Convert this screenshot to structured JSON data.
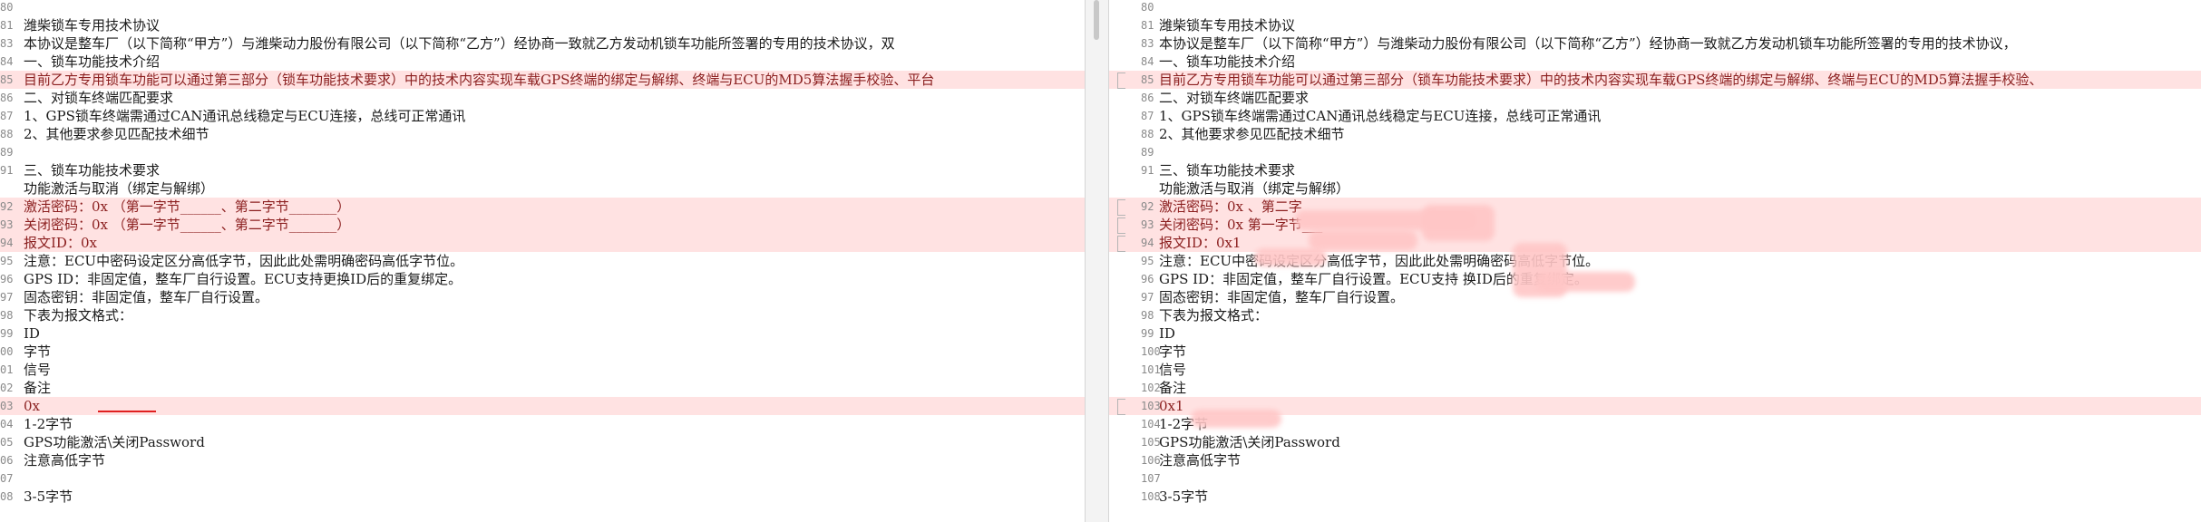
{
  "left_pane": {
    "lines": [
      {
        "num": "80",
        "text": "",
        "changed": false
      },
      {
        "num": "81",
        "text": "潍柴锁车专用技术协议",
        "changed": false
      },
      {
        "num": "83",
        "text": "本协议是整车厂（以下简称“甲方”）与潍柴动力股份有限公司（以下简称“乙方”）经协商一致就乙方发动机锁车功能所签署的专用的技术协议，双",
        "changed": false
      },
      {
        "num": "84",
        "text": "一、锁车功能技术介绍",
        "changed": false
      },
      {
        "num": "85",
        "text": "目前乙方专用锁车功能可以通过第三部分（锁车功能技术要求）中的技术内容实现车载GPS终端的绑定与解绑、终端与ECU的MD5算法握手校验、平台",
        "changed": true
      },
      {
        "num": "86",
        "text": "二、对锁车终端匹配要求",
        "changed": false
      },
      {
        "num": "87",
        "text": "1、GPS锁车终端需通过CAN通讯总线稳定与ECU连接，总线可正常通讯",
        "changed": false
      },
      {
        "num": "88",
        "text": "2、其他要求参见匹配技术细节",
        "changed": false
      },
      {
        "num": "89",
        "text": "",
        "changed": false
      },
      {
        "num": "91",
        "text": "三、锁车功能技术要求",
        "changed": false
      },
      {
        "num": "",
        "text": "功能激活与取消（绑定与解绑）",
        "changed": false
      },
      {
        "num": "92",
        "text": "  激活密码：0x  （第一字节______、第二字节_______）",
        "changed": true
      },
      {
        "num": "93",
        "text": "  关闭密码：0x  （第一字节______、第二字节_______）",
        "changed": true
      },
      {
        "num": "94",
        "text": "  报文ID：0x",
        "changed": true
      },
      {
        "num": "95",
        "text": "注意：ECU中密码设定区分高低字节，因此此处需明确密码高低字节位。",
        "changed": false
      },
      {
        "num": "96",
        "text": "GPS ID：非固定值，整车厂自行设置。ECU支持更换ID后的重复绑定。",
        "changed": false
      },
      {
        "num": "97",
        "text": "固态密钥：非固定值，整车厂自行设置。",
        "changed": false
      },
      {
        "num": "98",
        "text": "下表为报文格式：",
        "changed": false
      },
      {
        "num": "99",
        "text": "ID",
        "changed": false
      },
      {
        "num": "00",
        "text": "字节",
        "changed": false
      },
      {
        "num": "01",
        "text": "信号",
        "changed": false
      },
      {
        "num": "02",
        "text": "备注",
        "changed": false
      },
      {
        "num": "03",
        "text": "0x",
        "changed": true
      },
      {
        "num": "04",
        "text": "1-2字节",
        "changed": false
      },
      {
        "num": "05",
        "text": "GPS功能激活\\关闭Password",
        "changed": false
      },
      {
        "num": "06",
        "text": "注意高低字节",
        "changed": false
      },
      {
        "num": "07",
        "text": "",
        "changed": false
      },
      {
        "num": "08",
        "text": "3-5字节",
        "changed": false
      }
    ]
  },
  "right_pane": {
    "lines": [
      {
        "num": "80",
        "text": "",
        "changed": false
      },
      {
        "num": "81",
        "text": "潍柴锁车专用技术协议",
        "changed": false
      },
      {
        "num": "83",
        "text": "本协议是整车厂（以下简称“甲方”）与潍柴动力股份有限公司（以下简称“乙方”）经协商一致就乙方发动机锁车功能所签署的专用的技术协议，",
        "changed": false
      },
      {
        "num": "84",
        "text": "一、锁车功能技术介绍",
        "changed": false
      },
      {
        "num": "85",
        "text": "目前乙方专用锁车功能可以通过第三部分（锁车功能技术要求）中的技术内容实现车载GPS终端的绑定与解绑、终端与ECU的MD5算法握手校验、",
        "changed": true
      },
      {
        "num": "86",
        "text": "二、对锁车终端匹配要求",
        "changed": false
      },
      {
        "num": "87",
        "text": "1、GPS锁车终端需通过CAN通讯总线稳定与ECU连接，总线可正常通讯",
        "changed": false
      },
      {
        "num": "88",
        "text": "2、其他要求参见匹配技术细节",
        "changed": false
      },
      {
        "num": "89",
        "text": "",
        "changed": false
      },
      {
        "num": "91",
        "text": "三、锁车功能技术要求",
        "changed": false
      },
      {
        "num": "",
        "text": "功能激活与取消（绑定与解绑）",
        "changed": false
      },
      {
        "num": "92",
        "text": "  激活密码：0x              、第二字",
        "changed": true
      },
      {
        "num": "93",
        "text": "  关闭密码：0x        第一字节___",
        "changed": true
      },
      {
        "num": "94",
        "text": "  报文ID：0x1",
        "changed": true
      },
      {
        "num": "95",
        "text": "注意：ECU中密码设定区分高低字节，因此此处需明确密码高低字节位。",
        "changed": false
      },
      {
        "num": "96",
        "text": "GPS ID：非固定值，整车厂自行设置。ECU支持    换ID后的重复绑定。",
        "changed": false
      },
      {
        "num": "97",
        "text": "固态密钥：非固定值，整车厂自行设置。",
        "changed": false
      },
      {
        "num": "98",
        "text": "下表为报文格式：",
        "changed": false
      },
      {
        "num": "99",
        "text": "ID",
        "changed": false
      },
      {
        "num": "100",
        "text": "字节",
        "changed": false
      },
      {
        "num": "101",
        "text": "信号",
        "changed": false
      },
      {
        "num": "102",
        "text": "备注",
        "changed": false
      },
      {
        "num": "103",
        "text": "0x1",
        "changed": true
      },
      {
        "num": "104",
        "text": "1-2字节",
        "changed": false
      },
      {
        "num": "105",
        "text": "GPS功能激活\\关闭Password",
        "changed": false
      },
      {
        "num": "106",
        "text": "注意高低字节",
        "changed": false
      },
      {
        "num": "107",
        "text": "",
        "changed": false
      },
      {
        "num": "108",
        "text": "3-5字节",
        "changed": false
      }
    ]
  },
  "colors": {
    "changed_bg": "#ffe2e2",
    "changed_text": "#8b1f1f",
    "line_number": "#8a8a8a",
    "divider": "#f3f3f3"
  }
}
